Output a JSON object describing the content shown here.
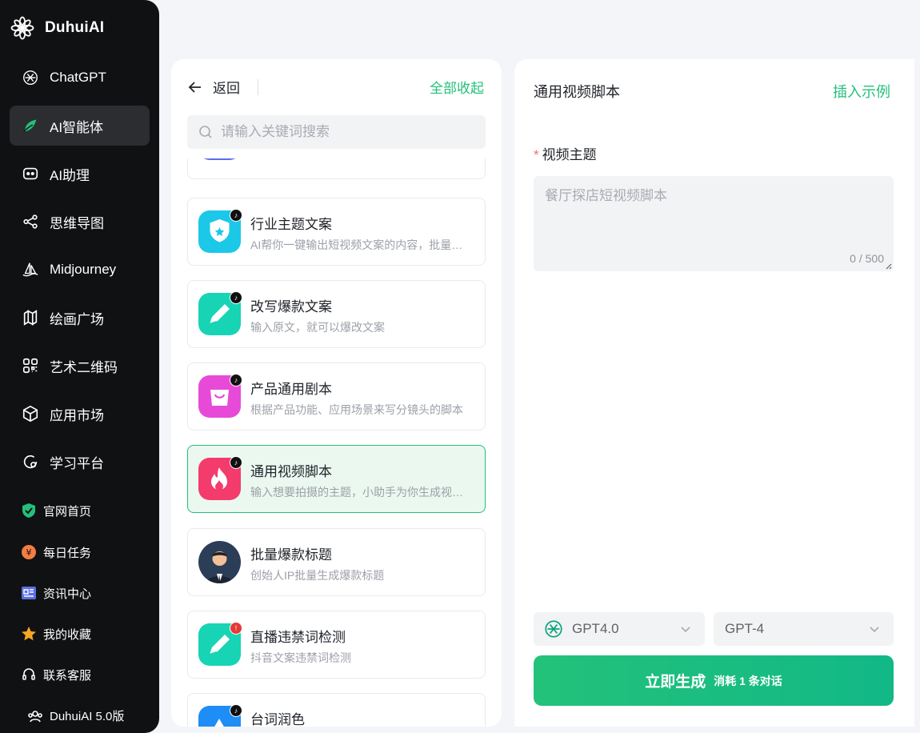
{
  "brand": {
    "name": "DuhuiAI"
  },
  "nav": [
    {
      "label": "ChatGPT",
      "icon": "openai-icon"
    },
    {
      "label": "AI智能体",
      "icon": "agent-leaf-icon",
      "active": true
    },
    {
      "label": "AI助理",
      "icon": "robot-icon"
    },
    {
      "label": "思维导图",
      "icon": "mindmap-icon"
    },
    {
      "label": "Midjourney",
      "icon": "sailboat-icon"
    },
    {
      "label": "绘画广场",
      "icon": "map-icon"
    },
    {
      "label": "艺术二维码",
      "icon": "qrcode-icon"
    },
    {
      "label": "应用市场",
      "icon": "cube-icon"
    },
    {
      "label": "学习平台",
      "icon": "study-icon"
    }
  ],
  "sub_nav": [
    {
      "label": "官网首页",
      "icon": "shield-check-icon",
      "color": "#22c07a"
    },
    {
      "label": "每日任务",
      "icon": "coin-icon",
      "color": "#f27d42"
    },
    {
      "label": "资讯中心",
      "icon": "news-icon",
      "color": "#5b6ee1"
    },
    {
      "label": "我的收藏",
      "icon": "star-icon",
      "color": "#f5a623"
    },
    {
      "label": "联系客服",
      "icon": "headset-icon",
      "color": "#ffffff"
    }
  ],
  "version": "DuhuiAI 5.0版",
  "middle": {
    "back_label": "返回",
    "collapse_all": "全部收起",
    "search_placeholder": "请输入关键词搜索",
    "items": [
      {
        "title": "行业主题文案",
        "desc": "AI帮你一键输出短视频文案的内容，批量生成",
        "icon": "shield-star-icon",
        "color": "#1cc8e8",
        "badge": "tiktok"
      },
      {
        "title": "改写爆款文案",
        "desc": "输入原文，就可以爆改文案",
        "icon": "pencil-icon",
        "color": "#17d4b4",
        "badge": "tiktok"
      },
      {
        "title": "产品通用剧本",
        "desc": "根据产品功能、应用场景来写分镜头的脚本",
        "icon": "shopping-bag-icon",
        "color": "#e84ad8",
        "badge": "tiktok"
      },
      {
        "title": "通用视频脚本",
        "desc": "输入想要拍摄的主题，小助手为你生成视频脚本",
        "icon": "flame-icon",
        "color": "#f33b6c",
        "badge": "tiktok",
        "selected": true
      },
      {
        "title": "批量爆款标题",
        "desc": "创始人IP批量生成爆款标题",
        "icon": "person-avatar-icon",
        "color": "#2c3e57",
        "badge": ""
      },
      {
        "title": "直播违禁词检测",
        "desc": "抖音文案违禁词检测",
        "icon": "pencil-icon",
        "color": "#17d4b4",
        "badge": "red"
      },
      {
        "title": "台词润色",
        "desc": "",
        "icon": "mountain-icon",
        "color": "#1e8df5",
        "badge": "tiktok"
      }
    ]
  },
  "right": {
    "title": "通用视频脚本",
    "insert_example": "插入示例",
    "field_label": "视频主题",
    "required_mark": "*",
    "textarea_placeholder": "餐厅探店短视频脚本",
    "char_count": "0 / 500",
    "model_select": "GPT4.0",
    "version_select": "GPT-4",
    "generate_label": "立即生成",
    "generate_cost": "消耗 1 条对话"
  },
  "colors": {
    "accent": "#22c07a",
    "sidebar_bg": "#101113",
    "page_bg": "#f3f5f8"
  }
}
